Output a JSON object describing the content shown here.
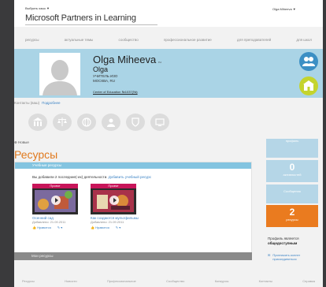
{
  "header": {
    "language": "Выбрать язык ▼",
    "brand": "Microsoft Partners in Learning",
    "user_menu": "Olga Miheeva ▼"
  },
  "nav": [
    "ресурсы",
    "актуальные темы",
    "сообщество",
    "профессиональное развитие",
    "для преподавателей",
    "для школ"
  ],
  "profile": {
    "name": "Olga Miheeva",
    "name_suffix": "ru",
    "first_name": "Olga",
    "role": "УЧИТЕЛЬ ИЗО",
    "city": "МОСКВА, RU",
    "center": "Center of Education №1037(№)"
  },
  "contacts": {
    "label": "Контакты (ваш)",
    "link": "Подробнее"
  },
  "badges": [
    "building-badge",
    "scales-badge",
    "globe-badge",
    "person-badge",
    "shield-badge",
    "screen-badge"
  ],
  "resources": {
    "lesson_count": "⊕ Новые",
    "title": "Ресурсы",
    "panel_head": "Учебные ресурсы",
    "desc_prefix": "Вы добавили 2 последние(-их) деятельности.",
    "desc_link": "Добавить учебный ресурс",
    "cards": [
      {
        "tag": "Проект",
        "title": "Осенний сад",
        "date": "Добавлено: 21.09.2011",
        "action1": "Нравится",
        "action2": "▾"
      },
      {
        "tag": "Проект",
        "title": "Как создаются мультфильмы",
        "date": "Добавлено: 21.09.2011",
        "action1": "Нравится",
        "action2": "▾"
      }
    ],
    "bottom_bar": "Мои ресурсы"
  },
  "stats": [
    {
      "num": "",
      "label": "профиль"
    },
    {
      "num": "0",
      "label": "активностей"
    },
    {
      "num": "",
      "label": "Сообщения"
    },
    {
      "num": "2",
      "label": "ресурсы"
    }
  ],
  "side": {
    "profile_note_1": "Профиль является",
    "profile_note_2": "общедоступным",
    "invite": "Пригласить коллег присоединиться"
  },
  "footer": [
    "Ресурсы",
    "Новости",
    "Профессиональное",
    "Сообщество",
    "Конкурсы",
    "Контакты",
    "Справка"
  ],
  "colors": {
    "profile_bg": "#aad4e6",
    "accent_orange": "#ea7b1f",
    "link_blue": "#3b82c4",
    "panel_head": "#83c4e0",
    "green_button": "#c4d42e"
  }
}
